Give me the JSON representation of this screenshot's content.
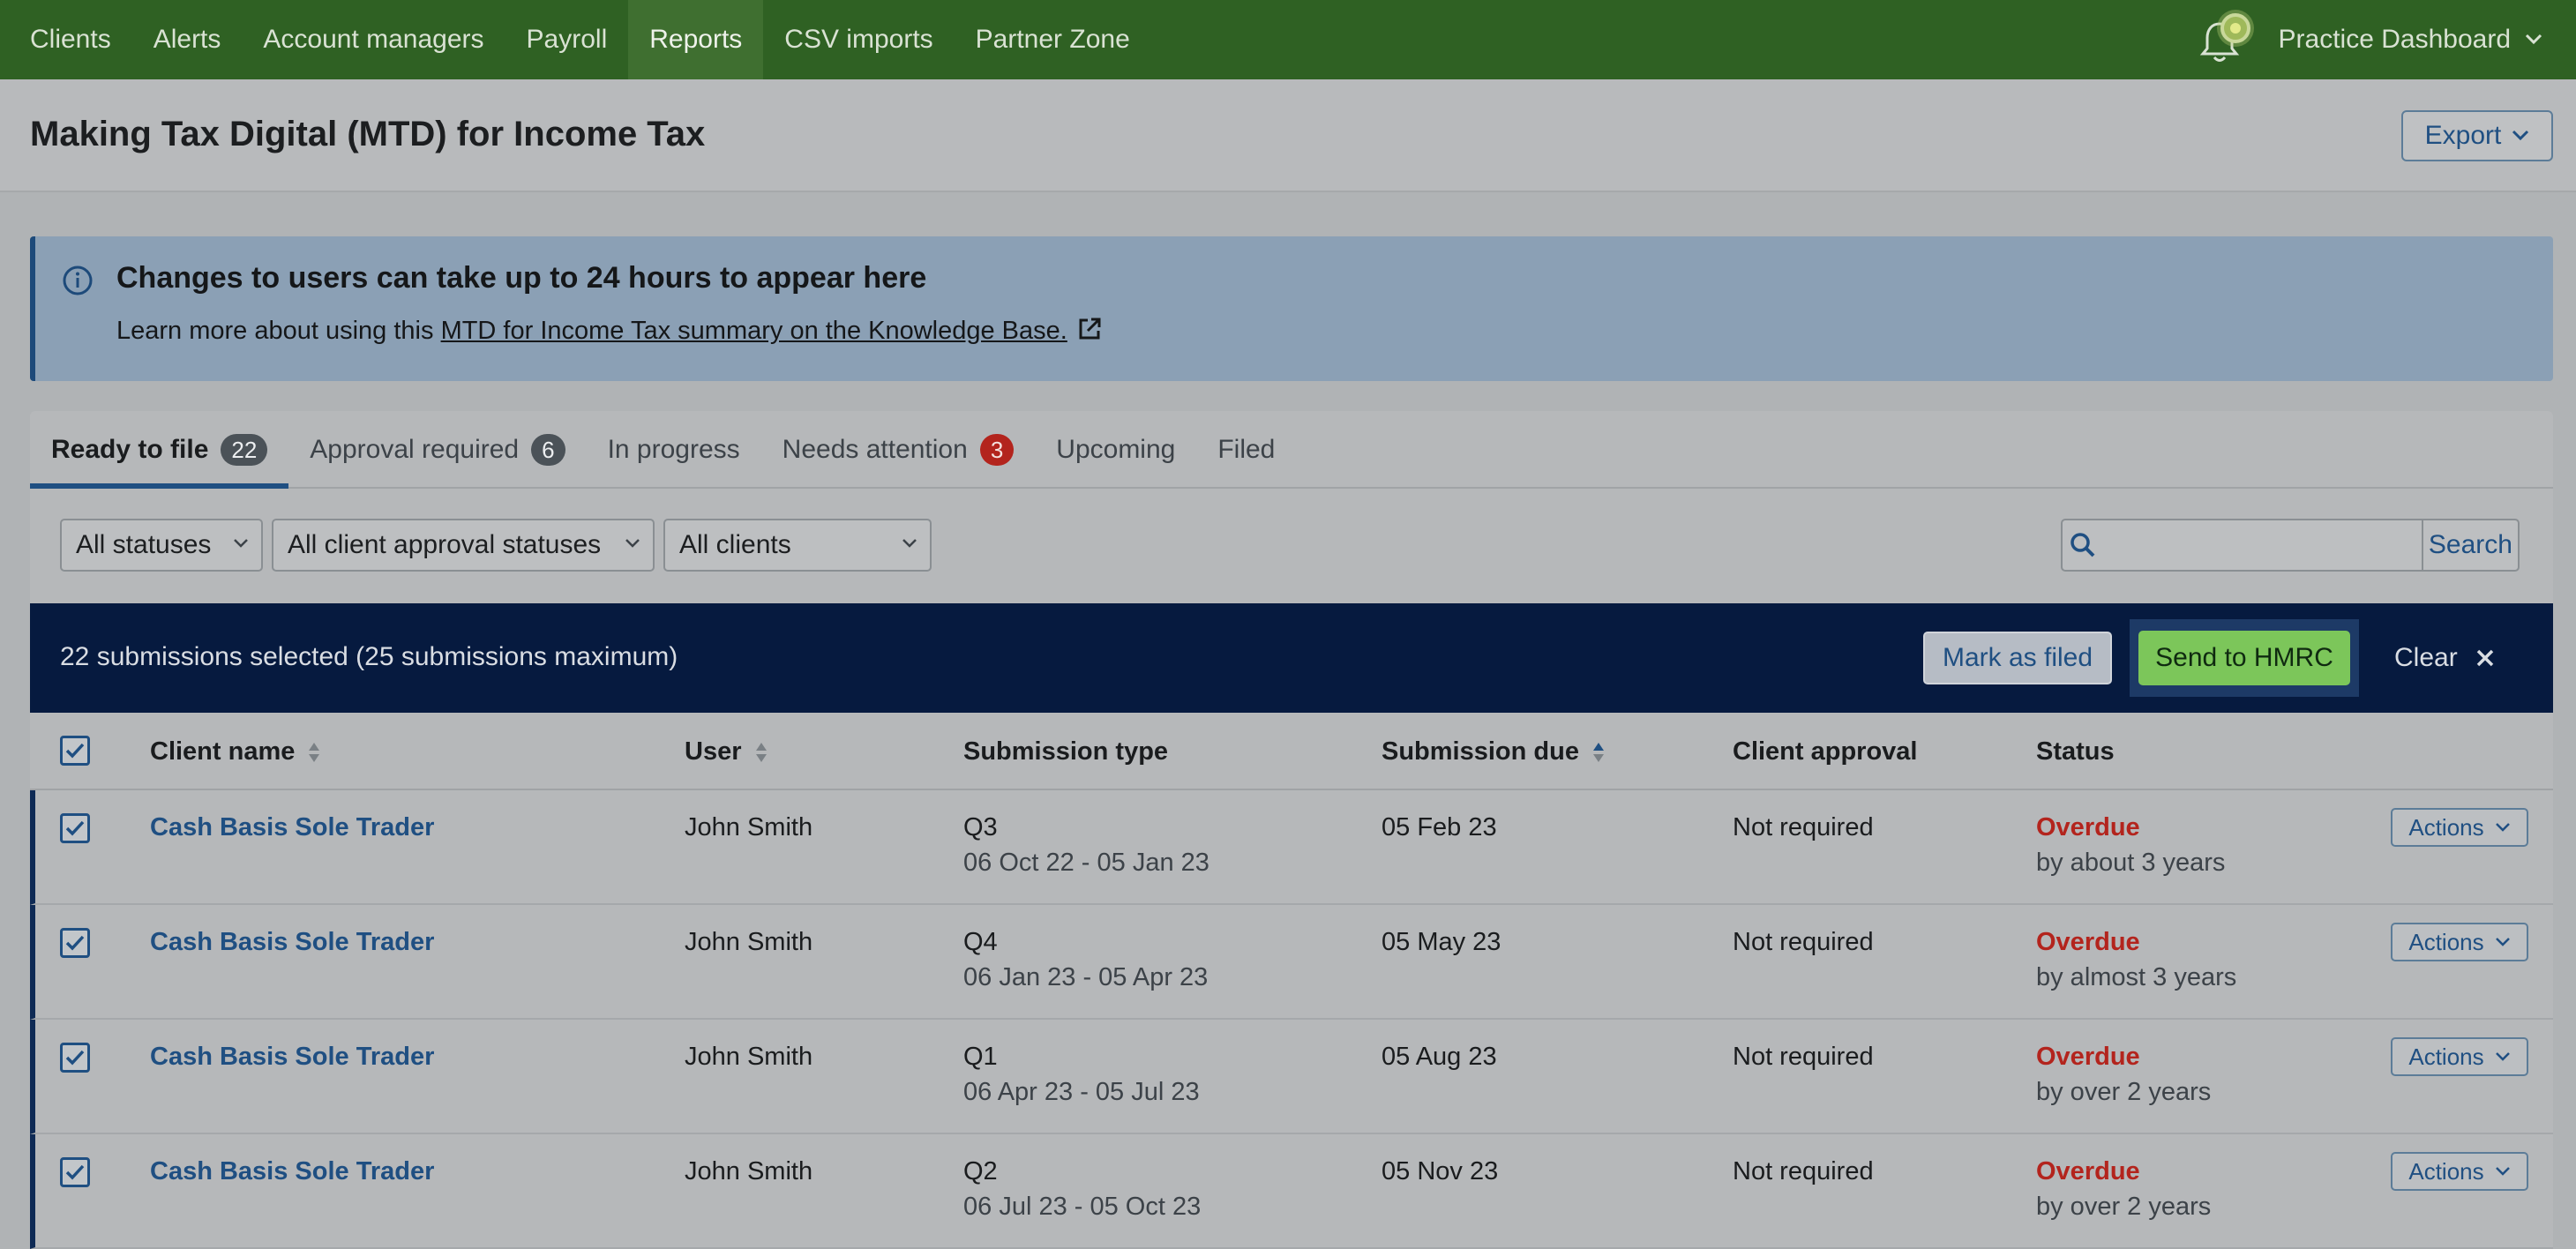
{
  "nav": {
    "items": [
      "Clients",
      "Alerts",
      "Account managers",
      "Payroll",
      "Reports",
      "CSV imports",
      "Partner Zone"
    ],
    "active_index": 4,
    "practice_label": "Practice Dashboard",
    "bell_icon": "bell-icon",
    "colors": {
      "nav_bg": "#2f6123",
      "accent": "#1f4f82",
      "overdue": "#b3241d",
      "send": "#7cc65a"
    }
  },
  "header": {
    "title": "Making Tax Digital (MTD) for Income Tax",
    "export_label": "Export"
  },
  "banner": {
    "title": "Changes to users can take up to 24 hours to appear here",
    "text_prefix": "Learn more about using this ",
    "link_text": "MTD for Income Tax summary on the Knowledge Base."
  },
  "tabs": [
    {
      "label": "Ready to file",
      "badge": "22",
      "badge_style": "dark",
      "active": true
    },
    {
      "label": "Approval required",
      "badge": "6",
      "badge_style": "dark",
      "active": false
    },
    {
      "label": "In progress",
      "badge": "",
      "active": false
    },
    {
      "label": "Needs attention",
      "badge": "3",
      "badge_style": "red",
      "active": false
    },
    {
      "label": "Upcoming",
      "badge": "",
      "active": false
    },
    {
      "label": "Filed",
      "badge": "",
      "active": false
    }
  ],
  "filters": {
    "status": "All statuses",
    "client_approval": "All client approval statuses",
    "clients": "All clients",
    "search_placeholder": "",
    "search_label": "Search"
  },
  "selection": {
    "text": "22 submissions selected (25 submissions maximum)",
    "mark_label": "Mark as filed",
    "send_label": "Send to HMRC",
    "clear_label": "Clear"
  },
  "table": {
    "headers": {
      "client": "Client name",
      "user": "User",
      "type": "Submission type",
      "due": "Submission due",
      "approval": "Client approval",
      "status": "Status"
    },
    "actions_label": "Actions",
    "rows": [
      {
        "client": "Cash Basis Sole Trader",
        "user": "John Smith",
        "quarter": "Q3",
        "period": "06 Oct 22 - 05 Jan 23",
        "due": "05 Feb 23",
        "approval": "Not required",
        "status": "Overdue",
        "status_detail": "by about 3 years"
      },
      {
        "client": "Cash Basis Sole Trader",
        "user": "John Smith",
        "quarter": "Q4",
        "period": "06 Jan 23 - 05 Apr 23",
        "due": "05 May 23",
        "approval": "Not required",
        "status": "Overdue",
        "status_detail": "by almost 3 years"
      },
      {
        "client": "Cash Basis Sole Trader",
        "user": "John Smith",
        "quarter": "Q1",
        "period": "06 Apr 23 - 05 Jul 23",
        "due": "05 Aug 23",
        "approval": "Not required",
        "status": "Overdue",
        "status_detail": "by over 2 years"
      },
      {
        "client": "Cash Basis Sole Trader",
        "user": "John Smith",
        "quarter": "Q2",
        "period": "06 Jul 23 - 05 Oct 23",
        "due": "05 Nov 23",
        "approval": "Not required",
        "status": "Overdue",
        "status_detail": "by over 2 years"
      }
    ]
  }
}
